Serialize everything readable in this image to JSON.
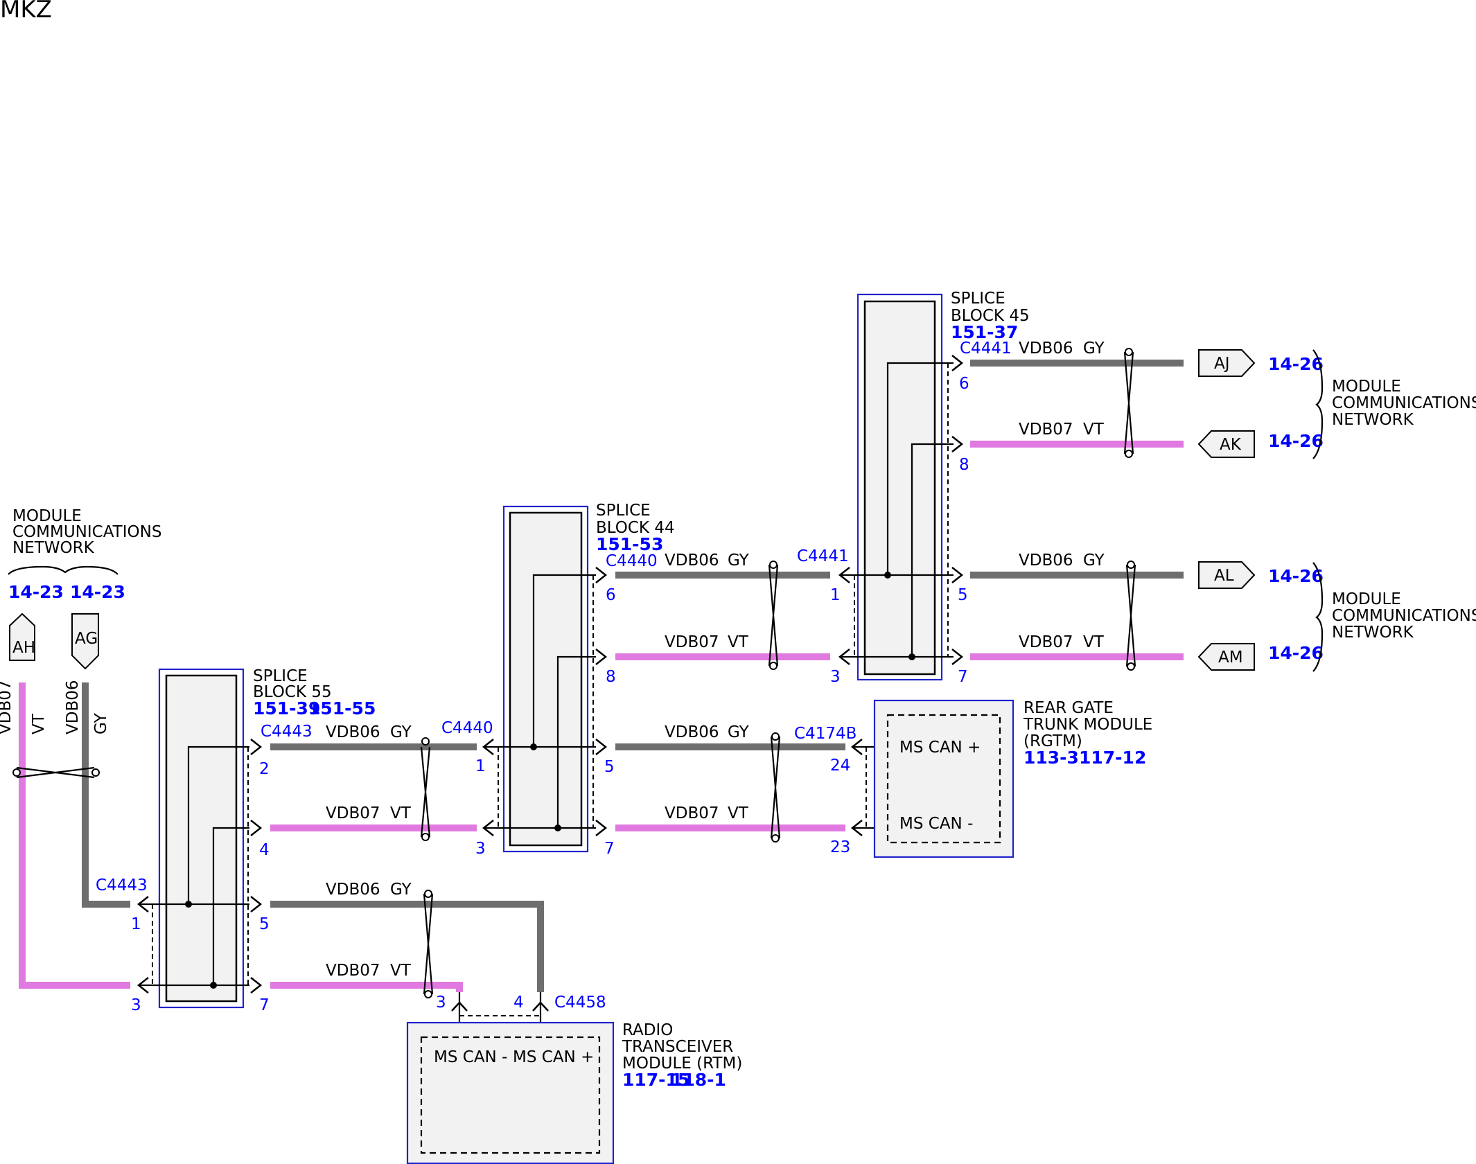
{
  "page_title": "MKZ",
  "colors": {
    "gy_wire": "#6e6e6e",
    "vt_wire": "#e07ae0",
    "ref_blue": "#0000ff",
    "block_border": "#2222cc",
    "module_fill": "#f2f2f2"
  },
  "left_network": {
    "line1": "MODULE",
    "line2": "COMMUNICATIONS",
    "line3": "NETWORK",
    "ref_ah": "14-23",
    "ref_ag": "14-23",
    "tag_ah": "AH",
    "tag_ag": "AG",
    "wire_vt_code": "VDB07",
    "wire_vt_color": "VT",
    "wire_gy_code": "VDB06",
    "wire_gy_color": "GY"
  },
  "splice55": {
    "line1": "SPLICE",
    "line2": "BLOCK 55",
    "ref1": "151-39",
    "ref2": "151-55",
    "connector_in": "C4443",
    "connector_out": "C4443",
    "pin_in_gy": "1",
    "pin_in_vt": "3",
    "pins_out": [
      "2",
      "4",
      "5",
      "7"
    ]
  },
  "splice44": {
    "line1": "SPLICE",
    "line2": "BLOCK 44",
    "ref": "151-53",
    "connector_in": "C4440",
    "connector_out": "C4440",
    "pins_in": [
      "1",
      "3"
    ],
    "pins_out": [
      "6",
      "8",
      "5",
      "7"
    ]
  },
  "splice45": {
    "line1": "SPLICE",
    "line2": "BLOCK 45",
    "ref": "151-37",
    "connector_in": "C4441",
    "connector_out": "C4441",
    "pins_in": [
      "1",
      "3"
    ],
    "pins_out": [
      "6",
      "8",
      "5",
      "7"
    ]
  },
  "wires": {
    "gy_code": "VDB06",
    "gy_color": "GY",
    "vt_code": "VDB07",
    "vt_color": "VT"
  },
  "rgtm": {
    "line1": "REAR GATE",
    "line2": "TRUNK MODULE",
    "line3": "(RGTM)",
    "ref1": "113-3",
    "ref2": "117-12",
    "connector": "C4174B",
    "pin_plus": "24",
    "pin_minus": "23",
    "pin_plus_label": "MS CAN +",
    "pin_minus_label": "MS CAN -"
  },
  "rtm": {
    "line1": "RADIO",
    "line2": "TRANSCEIVER",
    "line3": "MODULE (RTM)",
    "ref1": "117-15",
    "ref2": "118-1",
    "connector": "C4458",
    "pin_minus": "3",
    "pin_plus": "4",
    "pin_minus_label": "MS CAN -",
    "pin_plus_label": "MS CAN +"
  },
  "right_network": {
    "line1": "MODULE",
    "line2": "COMMUNICATIONS",
    "line3": "NETWORK",
    "tags": [
      "AJ",
      "AK",
      "AL",
      "AM"
    ],
    "refs": [
      "14-26",
      "14-26",
      "14-26",
      "14-26"
    ]
  }
}
